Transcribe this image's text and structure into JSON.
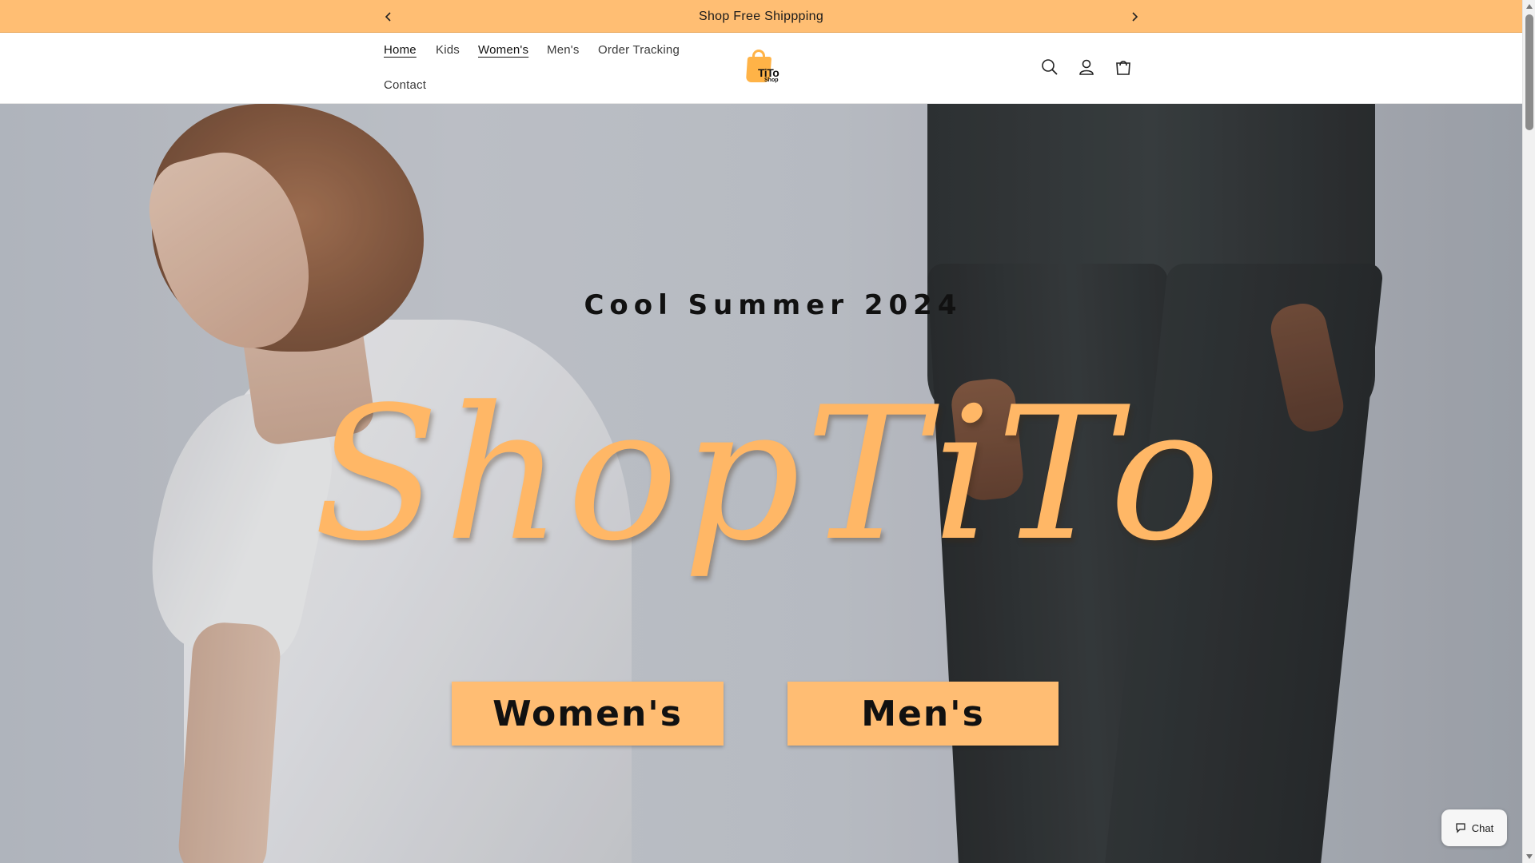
{
  "announcement": {
    "text": "Shop Free Shippping",
    "prev_icon": "chevron-left-icon",
    "next_icon": "chevron-right-icon"
  },
  "nav": {
    "items": [
      {
        "label": "Home",
        "state": "active"
      },
      {
        "label": "Kids"
      },
      {
        "label": "Women's",
        "state": "underlined"
      },
      {
        "label": "Men's"
      },
      {
        "label": "Order Tracking"
      },
      {
        "label": "Contact"
      }
    ]
  },
  "logo": {
    "main": "TiTo",
    "sub": "Shop"
  },
  "header_icons": [
    "search-icon",
    "account-icon",
    "cart-icon"
  ],
  "hero": {
    "subtitle": "Cool Summer 2024",
    "script_title": "ShopTiTo",
    "buttons": {
      "women": "Women's",
      "men": "Men's"
    }
  },
  "chat": {
    "label": "Chat",
    "icon": "chat-bubble-icon"
  },
  "colors": {
    "accent": "#ffbe73",
    "script": "#ffb766",
    "text": "#121212"
  }
}
